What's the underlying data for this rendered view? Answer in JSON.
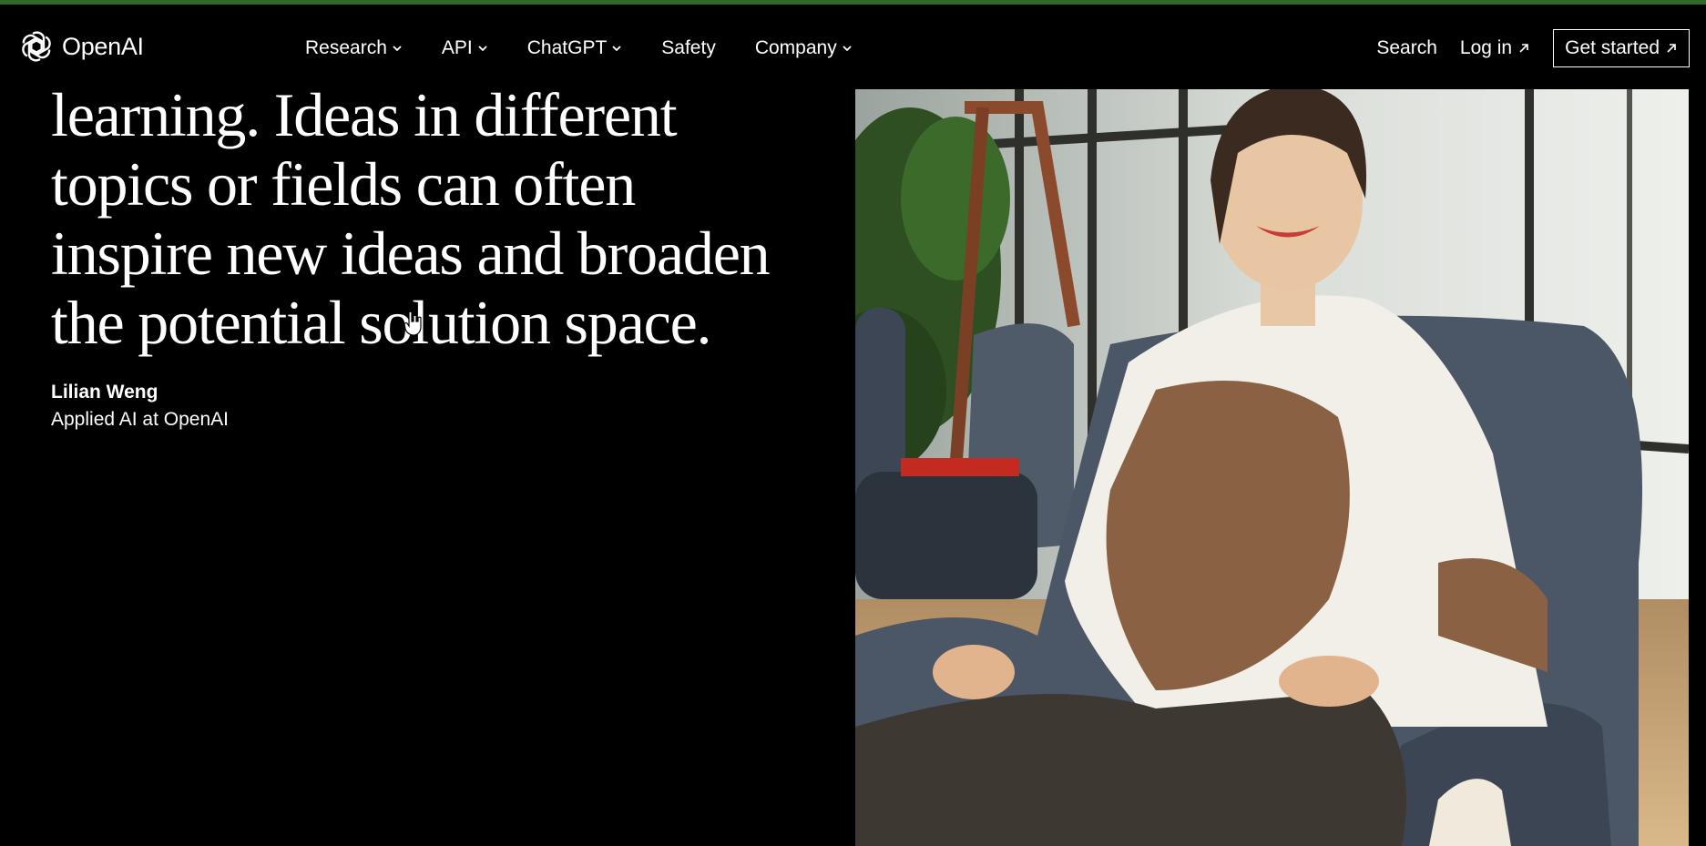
{
  "header": {
    "brand": "OpenAI",
    "logo_icon": "openai-logo-icon",
    "nav": [
      {
        "label": "Research",
        "has_dropdown": true
      },
      {
        "label": "API",
        "has_dropdown": true
      },
      {
        "label": "ChatGPT",
        "has_dropdown": true
      },
      {
        "label": "Safety",
        "has_dropdown": false
      },
      {
        "label": "Company",
        "has_dropdown": true
      }
    ],
    "search_label": "Search",
    "login_label": "Log in",
    "cta_label": "Get started"
  },
  "quote": {
    "lines": [
      "learning. Ideas in different",
      "topics or fields can often",
      "inspire new ideas and broaden",
      "the potential solution space."
    ]
  },
  "author": {
    "name": "Lilian Weng",
    "role": "Applied AI at OpenAI"
  },
  "colors": {
    "background": "#000000",
    "text": "#ffffff",
    "top_strip": "#2f6b2f"
  }
}
